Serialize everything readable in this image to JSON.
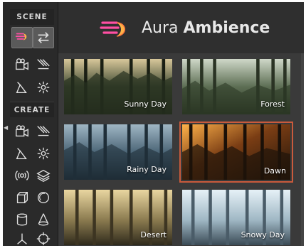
{
  "toolbar": {
    "scene_label": "SCENE",
    "create_label": "CREATE",
    "scene_tools": [
      {
        "icon": "aura-logo-icon",
        "active": true
      },
      {
        "icon": "swap-arrows-icon",
        "active": true
      },
      {
        "icon": "camera-icon"
      },
      {
        "icon": "directional-light-icon"
      },
      {
        "icon": "spotlight-icon"
      },
      {
        "icon": "point-light-icon"
      }
    ],
    "create_tools": [
      {
        "icon": "camera-icon"
      },
      {
        "icon": "directional-light-icon"
      },
      {
        "icon": "spotlight-icon"
      },
      {
        "icon": "point-light-icon"
      },
      {
        "icon": "audio-source-icon"
      },
      {
        "icon": "layers-icon"
      },
      {
        "icon": "cube-icon"
      },
      {
        "icon": "sphere-icon"
      },
      {
        "icon": "cylinder-icon"
      },
      {
        "icon": "cone-icon"
      },
      {
        "icon": "axes-gizmo-icon"
      },
      {
        "icon": "target-icon"
      }
    ]
  },
  "header": {
    "brand_light": "Aura",
    "brand_bold": "Ambience",
    "logo_icon": "aura-logo-icon",
    "colors": {
      "logo_pink": "#ff4fa3",
      "logo_orange": "#ffb347"
    }
  },
  "presets": [
    {
      "label": "Sunny Day",
      "selected": false,
      "palette": [
        "#d8c79a",
        "#3f4a32",
        "#1e2419"
      ]
    },
    {
      "label": "Forest",
      "selected": false,
      "palette": [
        "#cfd8c8",
        "#5d6e54",
        "#27301f"
      ]
    },
    {
      "label": "Rainy Day",
      "selected": false,
      "palette": [
        "#9fb6c4",
        "#4d6778",
        "#1d2a33"
      ]
    },
    {
      "label": "Dawn",
      "selected": true,
      "palette": [
        "#ffb24a",
        "#7a3d14",
        "#1f140a"
      ]
    },
    {
      "label": "Desert",
      "selected": false,
      "palette": [
        "#e9d6a0",
        "#8a7a4f",
        "#2f2a1c"
      ]
    },
    {
      "label": "Snowy Day",
      "selected": false,
      "palette": [
        "#e6f1f7",
        "#9fb7c4",
        "#3a4a55"
      ]
    }
  ],
  "accent": "#c95a3c"
}
